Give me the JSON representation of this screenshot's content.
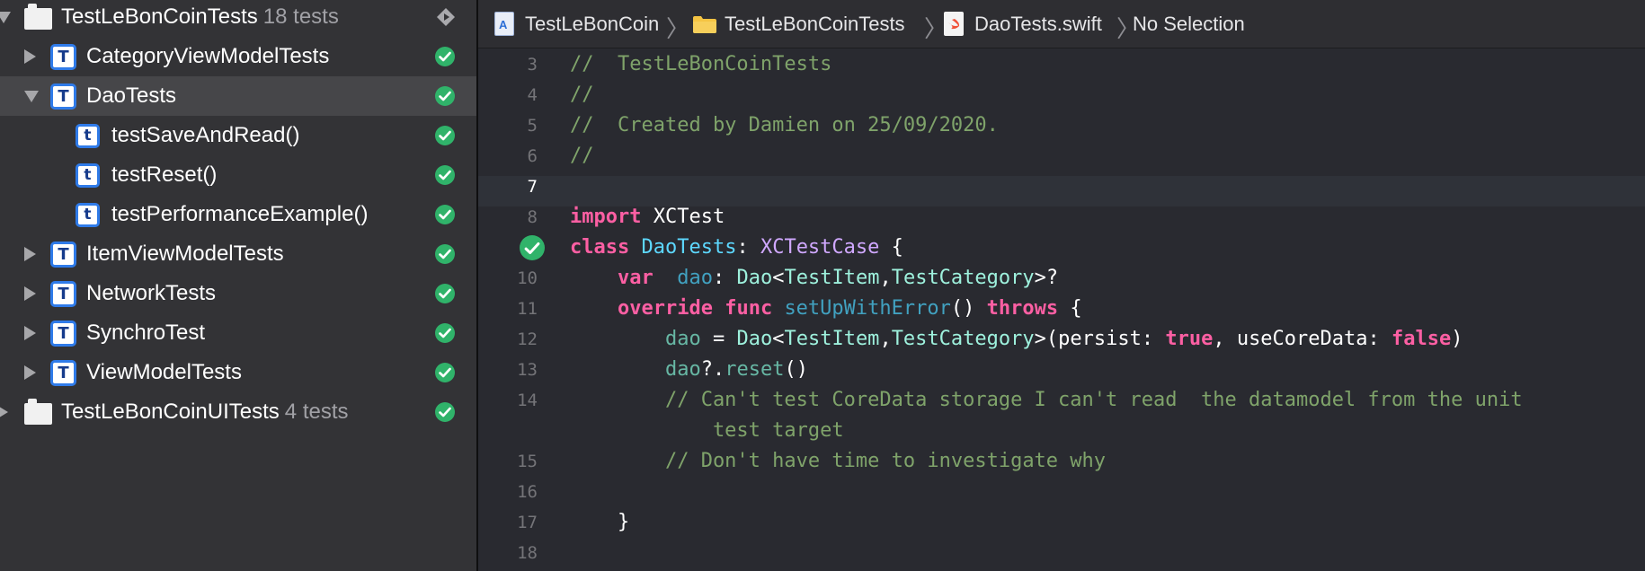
{
  "navigator": {
    "rows": [
      {
        "kind": "bundle",
        "label": "TestLeBonCoinTests",
        "count": "18 tests",
        "status": "run",
        "expanded": true
      },
      {
        "kind": "class",
        "label": "CategoryViewModelTests",
        "icon": "T",
        "status": "passed",
        "expanded": false
      },
      {
        "kind": "class",
        "label": "DaoTests",
        "icon": "T",
        "status": "passed",
        "expanded": true,
        "selected": true
      },
      {
        "kind": "method",
        "label": "testSaveAndRead()",
        "icon": "t",
        "status": "passed"
      },
      {
        "kind": "method",
        "label": "testReset()",
        "icon": "t",
        "status": "passed"
      },
      {
        "kind": "method",
        "label": "testPerformanceExample()",
        "icon": "t",
        "status": "passed"
      },
      {
        "kind": "class",
        "label": "ItemViewModelTests",
        "icon": "T",
        "status": "passed",
        "expanded": false
      },
      {
        "kind": "class",
        "label": "NetworkTests",
        "icon": "T",
        "status": "passed",
        "expanded": false
      },
      {
        "kind": "class",
        "label": "SynchroTest",
        "icon": "T",
        "status": "passed",
        "expanded": false
      },
      {
        "kind": "class",
        "label": "ViewModelTests",
        "icon": "T",
        "status": "passed",
        "expanded": false
      },
      {
        "kind": "bundle",
        "label": "TestLeBonCoinUITests",
        "count": "4 tests",
        "status": "passed",
        "expanded": false
      }
    ]
  },
  "jumpbar": {
    "project": "TestLeBonCoin",
    "folder": "TestLeBonCoinTests",
    "file": "DaoTests.swift",
    "selection": "No Selection"
  },
  "editor": {
    "current_line": "7",
    "lines": [
      {
        "n": "3",
        "segs": [
          {
            "t": "//  TestLeBonCoinTests",
            "c": "comment"
          }
        ]
      },
      {
        "n": "4",
        "segs": [
          {
            "t": "//",
            "c": "comment"
          }
        ]
      },
      {
        "n": "5",
        "segs": [
          {
            "t": "//  Created by Damien on 25/09/2020.",
            "c": "comment"
          }
        ]
      },
      {
        "n": "6",
        "segs": [
          {
            "t": "//",
            "c": "comment"
          }
        ]
      },
      {
        "n": "7",
        "segs": []
      },
      {
        "n": "8",
        "segs": [
          {
            "t": "import",
            "c": "kw"
          },
          {
            "t": " XCTest",
            "c": "plain"
          }
        ]
      },
      {
        "n": "",
        "pass": true,
        "segs": [
          {
            "t": "class",
            "c": "kw"
          },
          {
            "t": " ",
            "c": "plain"
          },
          {
            "t": "DaoTests",
            "c": "decl"
          },
          {
            "t": ": ",
            "c": "plain"
          },
          {
            "t": "XCTestCase",
            "c": "type"
          },
          {
            "t": " {",
            "c": "plain"
          }
        ]
      },
      {
        "n": "10",
        "segs": [
          {
            "t": "    ",
            "c": "plain"
          },
          {
            "t": "var",
            "c": "kw"
          },
          {
            "t": "  ",
            "c": "plain"
          },
          {
            "t": "dao",
            "c": "dim"
          },
          {
            "t": ": ",
            "c": "plain"
          },
          {
            "t": "Dao",
            "c": "proj"
          },
          {
            "t": "<",
            "c": "plain"
          },
          {
            "t": "TestItem",
            "c": "proj"
          },
          {
            "t": ",",
            "c": "plain"
          },
          {
            "t": "TestCategory",
            "c": "proj"
          },
          {
            "t": ">?",
            "c": "plain"
          }
        ]
      },
      {
        "n": "11",
        "segs": [
          {
            "t": "    ",
            "c": "plain"
          },
          {
            "t": "override",
            "c": "kw"
          },
          {
            "t": " ",
            "c": "plain"
          },
          {
            "t": "func",
            "c": "kw"
          },
          {
            "t": " ",
            "c": "plain"
          },
          {
            "t": "setUpWithError",
            "c": "dim"
          },
          {
            "t": "() ",
            "c": "plain"
          },
          {
            "t": "throws",
            "c": "kw"
          },
          {
            "t": " {",
            "c": "plain"
          }
        ]
      },
      {
        "n": "12",
        "segs": [
          {
            "t": "        ",
            "c": "plain"
          },
          {
            "t": "dao",
            "c": "call"
          },
          {
            "t": " = ",
            "c": "plain"
          },
          {
            "t": "Dao",
            "c": "proj"
          },
          {
            "t": "<",
            "c": "plain"
          },
          {
            "t": "TestItem",
            "c": "proj"
          },
          {
            "t": ",",
            "c": "plain"
          },
          {
            "t": "TestCategory",
            "c": "proj"
          },
          {
            "t": ">(persist: ",
            "c": "plain"
          },
          {
            "t": "true",
            "c": "kw"
          },
          {
            "t": ", useCoreData: ",
            "c": "plain"
          },
          {
            "t": "false",
            "c": "kw"
          },
          {
            "t": ")",
            "c": "plain"
          }
        ]
      },
      {
        "n": "13",
        "segs": [
          {
            "t": "        ",
            "c": "plain"
          },
          {
            "t": "dao",
            "c": "call"
          },
          {
            "t": "?.",
            "c": "plain"
          },
          {
            "t": "reset",
            "c": "call"
          },
          {
            "t": "()",
            "c": "plain"
          }
        ]
      },
      {
        "n": "14",
        "segs": [
          {
            "t": "        // Can't test CoreData storage I can't read  the datamodel from the unit",
            "c": "comment"
          }
        ]
      },
      {
        "n": "",
        "segs": [
          {
            "t": "            test target",
            "c": "comment"
          }
        ]
      },
      {
        "n": "15",
        "segs": [
          {
            "t": "        // Don't have time to investigate why",
            "c": "comment"
          }
        ]
      },
      {
        "n": "16",
        "segs": []
      },
      {
        "n": "17",
        "segs": [
          {
            "t": "    }",
            "c": "plain"
          }
        ]
      },
      {
        "n": "18",
        "segs": []
      }
    ]
  }
}
